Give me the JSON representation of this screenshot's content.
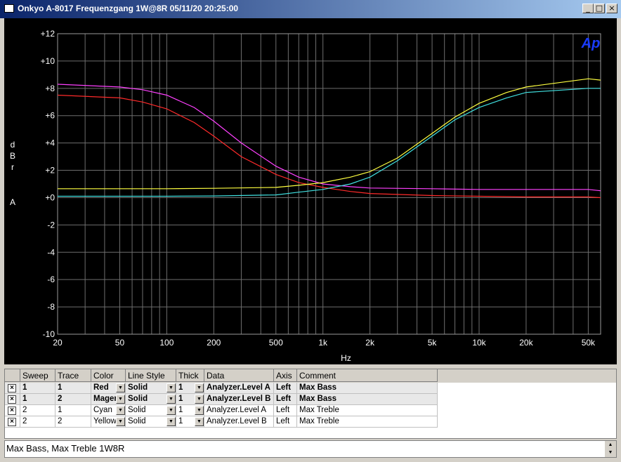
{
  "window": {
    "title": "Onkyo A-8017 Frequenzgang 1W@8R  05/11/20 20:25:00",
    "buttons": [
      "_",
      "□",
      "×"
    ]
  },
  "chart_data": {
    "type": "line",
    "logo": "Ap",
    "ylabel_lines": [
      "d",
      "B",
      "r",
      "",
      "A"
    ],
    "xlabel": "Hz",
    "xscale": "log",
    "xlim": [
      20,
      60000
    ],
    "ylim": [
      -10,
      12
    ],
    "xticks": [
      20,
      50,
      100,
      200,
      500,
      1000,
      2000,
      5000,
      10000,
      20000,
      50000
    ],
    "xtick_labels": [
      "20",
      "50",
      "100",
      "200",
      "500",
      "1k",
      "2k",
      "5k",
      "10k",
      "20k",
      "50k"
    ],
    "yticks": [
      12,
      10,
      8,
      6,
      4,
      2,
      0,
      -2,
      -4,
      -6,
      -8,
      -10
    ],
    "ytick_labels": [
      "+12",
      "+10",
      "+8",
      "+6",
      "+4",
      "+2",
      "+0",
      "-2",
      "-4",
      "-6",
      "-8",
      "-10"
    ],
    "grid": true,
    "series": [
      {
        "color": "#ff2a2a",
        "x": [
          20,
          50,
          70,
          100,
          150,
          200,
          300,
          500,
          700,
          1000,
          1500,
          2000,
          5000,
          10000,
          20000,
          50000,
          60000
        ],
        "y": [
          7.5,
          7.3,
          7.0,
          6.5,
          5.5,
          4.5,
          3.0,
          1.7,
          1.1,
          0.75,
          0.45,
          0.3,
          0.15,
          0.1,
          0.05,
          0.05,
          0.0
        ]
      },
      {
        "color": "#ff40ff",
        "x": [
          20,
          50,
          70,
          100,
          150,
          200,
          300,
          500,
          700,
          1000,
          1500,
          2000,
          5000,
          10000,
          20000,
          50000,
          60000
        ],
        "y": [
          8.3,
          8.1,
          7.9,
          7.5,
          6.6,
          5.6,
          4.0,
          2.3,
          1.5,
          1.0,
          0.8,
          0.7,
          0.65,
          0.6,
          0.6,
          0.6,
          0.5
        ]
      },
      {
        "color": "#40e0e0",
        "x": [
          20,
          100,
          200,
          500,
          700,
          1000,
          1500,
          2000,
          3000,
          5000,
          7000,
          10000,
          15000,
          20000,
          50000,
          60000
        ],
        "y": [
          0.1,
          0.1,
          0.12,
          0.2,
          0.4,
          0.6,
          1.0,
          1.5,
          2.7,
          4.5,
          5.7,
          6.6,
          7.3,
          7.7,
          8.0,
          8.0
        ]
      },
      {
        "color": "#ffff40",
        "x": [
          20,
          100,
          200,
          500,
          700,
          1000,
          1500,
          2000,
          3000,
          5000,
          7000,
          10000,
          15000,
          20000,
          50000,
          60000
        ],
        "y": [
          0.65,
          0.65,
          0.68,
          0.75,
          0.9,
          1.1,
          1.5,
          1.9,
          2.9,
          4.7,
          5.9,
          6.9,
          7.7,
          8.1,
          8.7,
          8.6
        ]
      }
    ]
  },
  "table": {
    "columns": [
      "Sweep",
      "Trace",
      "Color",
      "Line Style",
      "Thick",
      "Data",
      "Axis",
      "Comment"
    ],
    "rows": [
      {
        "enabled": "×",
        "sweep": "1",
        "trace": "1",
        "color": "Red",
        "style": "Solid",
        "thick": "1",
        "data": "Analyzer.Level A",
        "axis": "Left",
        "comment": "Max Bass"
      },
      {
        "enabled": "×",
        "sweep": "1",
        "trace": "2",
        "color": "Magenta",
        "style": "Solid",
        "thick": "1",
        "data": "Analyzer.Level B",
        "axis": "Left",
        "comment": "Max Bass"
      },
      {
        "enabled": "×",
        "sweep": "2",
        "trace": "1",
        "color": "Cyan",
        "style": "Solid",
        "thick": "1",
        "data": "Analyzer.Level A",
        "axis": "Left",
        "comment": "Max Treble"
      },
      {
        "enabled": "×",
        "sweep": "2",
        "trace": "2",
        "color": "Yellow",
        "style": "Solid",
        "thick": "1",
        "data": "Analyzer.Level B",
        "axis": "Left",
        "comment": "Max Treble"
      }
    ]
  },
  "status": {
    "text": "Max Bass, Max Treble 1W8R",
    "scroll_up": "▲",
    "scroll_down": "▼"
  },
  "dropdown_arrow": "▼"
}
